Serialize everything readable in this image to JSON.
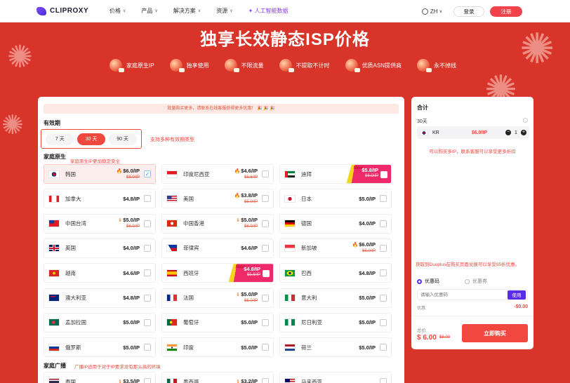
{
  "header": {
    "logo_text": "CLIPROXY",
    "nav": [
      {
        "label": "价格",
        "chev": true
      },
      {
        "label": "产品",
        "chev": true
      },
      {
        "label": "解决方案",
        "chev": true
      },
      {
        "label": "资源",
        "chev": true
      }
    ],
    "ai_label": "✦ 人工智能数据",
    "lang": "ZH",
    "login": "登录",
    "signup": "注册"
  },
  "hero": {
    "title": "独享长效静态ISP价格",
    "features": [
      "家庭原生IP",
      "独享使用",
      "不限流量",
      "不提取不计时",
      "优质ASN提供商",
      "永不掉线"
    ]
  },
  "main": {
    "promo": "批量购买更多，请联系在线客服获得更多优惠！ 🎉 🎉 🎉",
    "period_title": "有效期",
    "periods": [
      "7 天",
      "30 天",
      "90 天"
    ],
    "period_selected": 1,
    "period_note": "支持多种有效期类型",
    "home_title": "家庭原生",
    "home_note": "家庭原生IP更加稳定安全",
    "broadcast_title": "家庭广播",
    "broadcast_note": "广播IP适用于对于IP要求没有那么高的环境",
    "countries": [
      {
        "name": "韩国",
        "price": "$6.0/IP",
        "old": "$8.0/IP",
        "fire": true,
        "selected": true
      },
      {
        "name": "印度尼西亚",
        "price": "$4.6/IP",
        "old": "$5.6/IP",
        "fire": true
      },
      {
        "name": "迪拜",
        "price": "$5.8/IP",
        "old": "$8.0/IP",
        "new": true
      },
      {
        "name": "加拿大",
        "price": "$4.8/IP"
      },
      {
        "name": "美国",
        "price": "$3.8/IP",
        "old": "$5.0/IP",
        "fire": true
      },
      {
        "name": "日本",
        "price": "$5.0/IP"
      },
      {
        "name": "中国台湾",
        "price": "$5.0/IP",
        "old": "$6.0/IP",
        "arrow": true
      },
      {
        "name": "中国香港",
        "price": "$5.0/IP",
        "old": "$6.0/IP",
        "arrow": true
      },
      {
        "name": "德国",
        "price": "$4.0/IP"
      },
      {
        "name": "英国",
        "price": "$4.0/IP"
      },
      {
        "name": "菲律宾",
        "price": "$4.6/IP"
      },
      {
        "name": "新加坡",
        "price": "$6.0/IP",
        "old": "$8.0/IP",
        "fire": true
      },
      {
        "name": "越南",
        "price": "$4.6/IP"
      },
      {
        "name": "西班牙",
        "price": "$4.8/IP",
        "old": "$5.6/IP",
        "new": true
      },
      {
        "name": "巴西",
        "price": "$4.8/IP"
      },
      {
        "name": "澳大利亚",
        "price": "$4.8/IP"
      },
      {
        "name": "法国",
        "price": "$5.0/IP",
        "old": "$6.0/IP",
        "arrow": true
      },
      {
        "name": "意大利",
        "price": "$5.0/IP"
      },
      {
        "name": "孟加拉国",
        "price": "$5.0/IP"
      },
      {
        "name": "葡萄牙",
        "price": "$5.0/IP"
      },
      {
        "name": "尼日利亚",
        "price": "$5.0/IP"
      },
      {
        "name": "俄罗斯",
        "price": "$5.0/IP"
      },
      {
        "name": "印度",
        "price": "$5.0/IP"
      },
      {
        "name": "荷兰",
        "price": "$5.0/IP"
      },
      {
        "name": "泰国",
        "price": "$3.5/IP",
        "arrow": true
      },
      {
        "name": "墨西哥",
        "price": "$3.2/IP",
        "arrow": true
      },
      {
        "name": "马来西亚",
        "price": ""
      }
    ]
  },
  "side": {
    "title": "合计",
    "period": "30天",
    "item_code": "KR",
    "item_price": "$6.0/IP",
    "qty": "1",
    "bulk_tip": "可以购买多IP，联系客服可以享受更多折扣",
    "coupon_note": "获取到Duoplus在购买页面兑换可以享受95折优惠。",
    "radio1": "优惠码",
    "radio2": "优惠券",
    "coupon_placeholder": "请输入优惠码",
    "use": "使用",
    "discount_label": "优惠:",
    "discount_value": "-$0.00",
    "total_label": "总价",
    "total": "$ 6.00",
    "total_old": "$8.00",
    "buy": "立即购买"
  },
  "colors": {
    "accent": "#f0473e",
    "brand": "#5b2ce8",
    "hero_bg": "#d8342a"
  }
}
